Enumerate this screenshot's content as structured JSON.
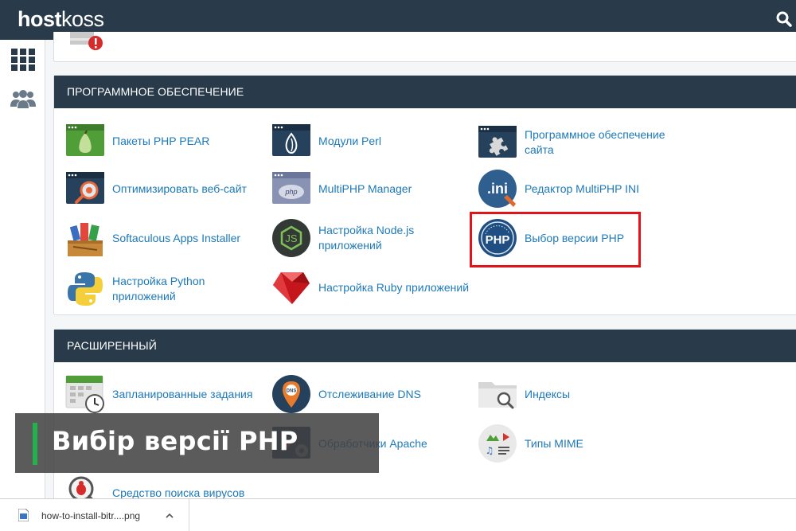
{
  "header": {
    "logo_bold": "host",
    "logo_light": "koss",
    "search_icon": "search-icon"
  },
  "sidebar": {
    "items": [
      {
        "icon": "grid-icon"
      },
      {
        "icon": "users-icon"
      }
    ]
  },
  "software": {
    "title": "ПРОГРАММНОЕ ОБЕСПЕЧЕНИЕ",
    "items": [
      {
        "label": "Пакеты PHP PEAR",
        "icon": "pear-icon"
      },
      {
        "label": "Модули Perl",
        "icon": "perl-icon"
      },
      {
        "label": "Программное обеспечение сайта",
        "icon": "puzzle-icon"
      },
      {
        "label": "Оптимизировать веб-сайт",
        "icon": "optimize-icon"
      },
      {
        "label": "MultiPHP Manager",
        "icon": "php-manager-icon"
      },
      {
        "label": "Редактор MultiPHP INI",
        "icon": "ini-icon"
      },
      {
        "label": "Softaculous Apps Installer",
        "icon": "softaculous-icon"
      },
      {
        "label": "Настройка Node.js приложений",
        "icon": "nodejs-icon"
      },
      {
        "label": "Выбор версии PHP",
        "icon": "php-version-icon"
      },
      {
        "label": "Настройка Python приложений",
        "icon": "python-icon"
      },
      {
        "label": "Настройка Ruby приложений",
        "icon": "ruby-icon"
      }
    ]
  },
  "advanced": {
    "title": "РАСШИРЕННЫЙ",
    "items": [
      {
        "label": "Запланированные задания",
        "icon": "calendar-clock-icon"
      },
      {
        "label": "Отслеживание DNS",
        "icon": "dns-icon"
      },
      {
        "label": "Индексы",
        "icon": "folder-search-icon"
      },
      {
        "label": "Обработчики Apache",
        "icon": "apache-icon"
      },
      {
        "label": "Типы MIME",
        "icon": "mime-icon"
      },
      {
        "label": "Средство поиска вирусов",
        "icon": "virus-scan-icon"
      }
    ]
  },
  "caption": {
    "text": "Вибір версії PHP"
  },
  "download": {
    "filename": "how-to-install-bitr....png"
  },
  "colors": {
    "header_bg": "#293a4a",
    "link": "#1d79b8",
    "highlight": "#e2141a",
    "caption_accent": "#22b14c"
  }
}
